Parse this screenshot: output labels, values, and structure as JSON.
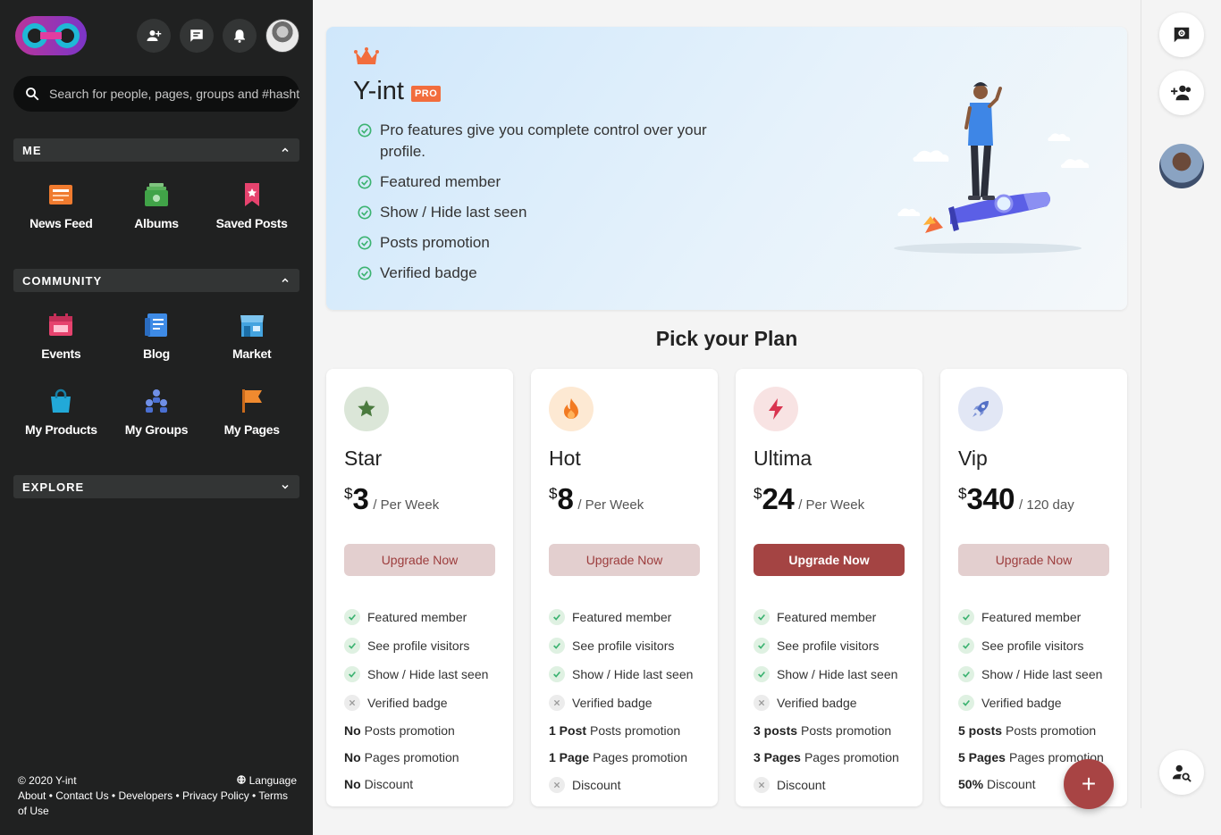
{
  "app": {
    "brand": "Y-int"
  },
  "search": {
    "placeholder": "Search for people, pages, groups and #hashtags"
  },
  "sidebar": {
    "me_title": "ME",
    "me_items": [
      {
        "label": "News Feed",
        "icon": "news-feed-icon",
        "color": "#f07b2f"
      },
      {
        "label": "Albums",
        "icon": "albums-icon",
        "color": "#41a348"
      },
      {
        "label": "Saved Posts",
        "icon": "saved-posts-icon",
        "color": "#e6436e"
      }
    ],
    "community_title": "COMMUNITY",
    "community_items": [
      {
        "label": "Events",
        "icon": "events-icon",
        "color": "#e6436e"
      },
      {
        "label": "Blog",
        "icon": "blog-icon",
        "color": "#3e8be6"
      },
      {
        "label": "Market",
        "icon": "market-icon",
        "color": "#44a4e0"
      },
      {
        "label": "My Products",
        "icon": "my-products-icon",
        "color": "#22a9d8"
      },
      {
        "label": "My Groups",
        "icon": "my-groups-icon",
        "color": "#4a6fd1"
      },
      {
        "label": "My Pages",
        "icon": "my-pages-icon",
        "color": "#f08a2f"
      }
    ],
    "explore_title": "EXPLORE",
    "footer": {
      "copyright": "© 2020 Y-int",
      "language": "Language",
      "links": "About • Contact Us • Developers • Privacy Policy • Terms of Use"
    }
  },
  "hero": {
    "title": "Y-int",
    "badge": "PRO",
    "features": [
      "Pro features give you complete control over your profile.",
      "Featured member",
      "Show / Hide last seen",
      "Posts promotion",
      "Verified badge"
    ]
  },
  "pick_title": "Pick your Plan",
  "plans": [
    {
      "name": "Star",
      "currency": "$",
      "amount": "3",
      "period": "/ Per Week",
      "button": "Upgrade Now",
      "checks": [
        {
          "label": "Featured member",
          "ok": true
        },
        {
          "label": "See profile visitors",
          "ok": true
        },
        {
          "label": "Show / Hide last seen",
          "ok": true
        },
        {
          "label": "Verified badge",
          "ok": false
        }
      ],
      "posts_prefix": "No",
      "posts_label": "Posts promotion",
      "pages_prefix": "No",
      "pages_label": "Pages promotion",
      "discount_prefix": "No",
      "discount_label": "Discount"
    },
    {
      "name": "Hot",
      "currency": "$",
      "amount": "8",
      "period": "/ Per Week",
      "button": "Upgrade Now",
      "checks": [
        {
          "label": "Featured member",
          "ok": true
        },
        {
          "label": "See profile visitors",
          "ok": true
        },
        {
          "label": "Show / Hide last seen",
          "ok": true
        },
        {
          "label": "Verified badge",
          "ok": false
        }
      ],
      "posts_prefix": "1 Post",
      "posts_label": "Posts promotion",
      "pages_prefix": "1 Page",
      "pages_label": "Pages promotion",
      "discount_label": "Discount"
    },
    {
      "name": "Ultima",
      "currency": "$",
      "amount": "24",
      "period": "/ Per Week",
      "button": "Upgrade Now",
      "checks": [
        {
          "label": "Featured member",
          "ok": true
        },
        {
          "label": "See profile visitors",
          "ok": true
        },
        {
          "label": "Show / Hide last seen",
          "ok": true
        },
        {
          "label": "Verified badge",
          "ok": false
        }
      ],
      "posts_prefix": "3 posts",
      "posts_label": "Posts promotion",
      "pages_prefix": "3 Pages",
      "pages_label": "Pages promotion",
      "discount_label": "Discount"
    },
    {
      "name": "Vip",
      "currency": "$",
      "amount": "340",
      "period": "/ 120 day",
      "button": "Upgrade Now",
      "checks": [
        {
          "label": "Featured member",
          "ok": true
        },
        {
          "label": "See profile visitors",
          "ok": true
        },
        {
          "label": "Show / Hide last seen",
          "ok": true
        },
        {
          "label": "Verified badge",
          "ok": true
        }
      ],
      "posts_prefix": "5 posts",
      "posts_label": "Posts promotion",
      "pages_prefix": "5 Pages",
      "pages_label": "Pages promotion",
      "discount_prefix": "50%",
      "discount_label": "Discount"
    }
  ],
  "fab": {
    "label": "+"
  },
  "colors": {
    "accent": "#a44443",
    "sidebar_bg": "#202121",
    "check_green": "#3cb371"
  }
}
